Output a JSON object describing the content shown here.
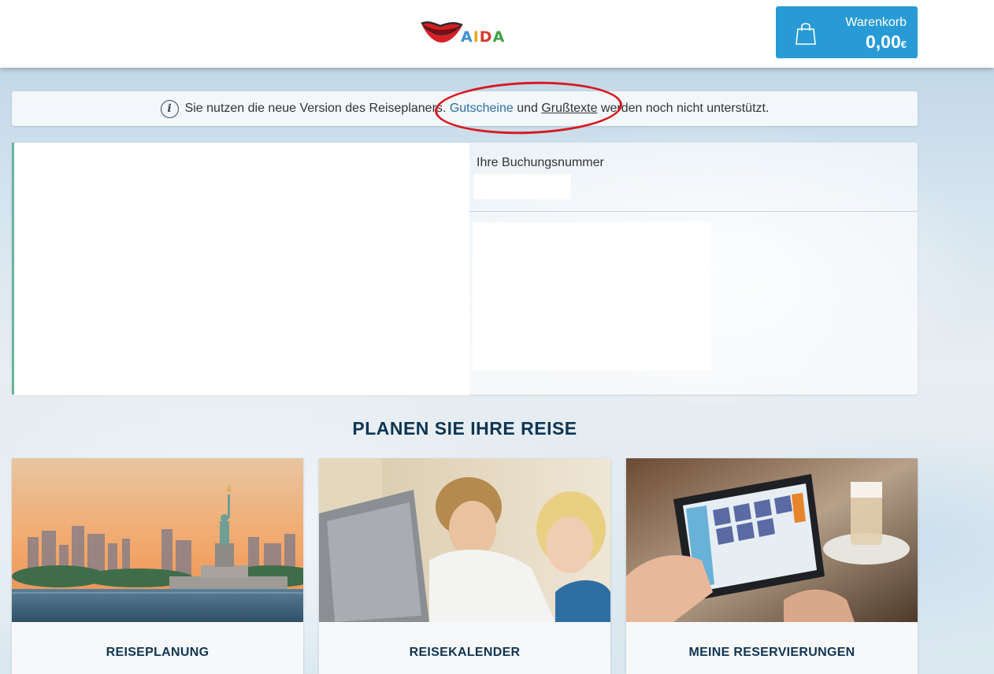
{
  "header": {
    "logo": {
      "icon": "kiss-mouth-logo",
      "text": "AIDA"
    },
    "cart": {
      "label": "Warenkorb",
      "amount": "0,00",
      "currency": "€",
      "icon": "shopping-bag-icon"
    }
  },
  "info_banner": {
    "icon": "info-icon",
    "text_before": "Sie nutzen die neue Version des Reiseplaners.",
    "link_vouchers": "Gutscheine",
    "text_and": "und",
    "link_greetings": "Grußtexte",
    "text_after": "werden noch nicht unterstützt."
  },
  "booking": {
    "number_label": "Ihre Buchungsnummer"
  },
  "planning": {
    "title": "PLANEN SIE IHRE REISE",
    "cards": [
      {
        "label": "REISEPLANUNG",
        "image": "statue-of-liberty-skyline"
      },
      {
        "label": "REISEKALENDER",
        "image": "couple-with-laptop"
      },
      {
        "label": "MEINE RESERVIERUNGEN",
        "image": "tablet-app-coffee"
      }
    ]
  },
  "colors": {
    "cart_bg": "#289bd6",
    "heading": "#0f3552",
    "link": "#2c6fa3",
    "highlight_ring": "#d71920"
  }
}
